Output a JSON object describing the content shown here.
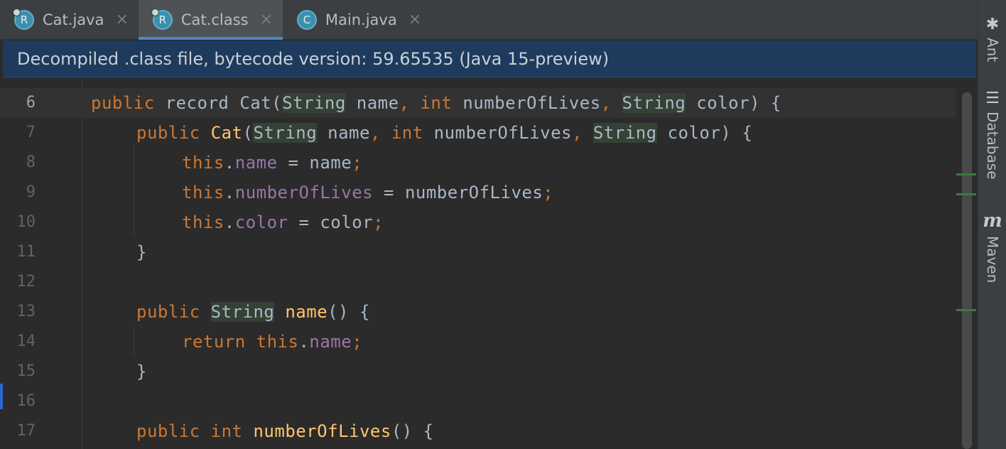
{
  "tabs": [
    {
      "icon_letter": "R",
      "label": "Cat.java",
      "close": "×",
      "active": false
    },
    {
      "icon_letter": "R",
      "label": "Cat.class",
      "close": "×",
      "active": true
    },
    {
      "icon_letter": "C",
      "label": "Main.java",
      "close": "×",
      "active": false
    }
  ],
  "banner": {
    "text": "Decompiled .class file, bytecode version: 59.65535 (Java 15-preview)"
  },
  "editor": {
    "lines": [
      {
        "num": "6"
      },
      {
        "num": "7"
      },
      {
        "num": "8"
      },
      {
        "num": "9"
      },
      {
        "num": "10"
      },
      {
        "num": "11"
      },
      {
        "num": "12"
      },
      {
        "num": "13"
      },
      {
        "num": "14"
      },
      {
        "num": "15"
      },
      {
        "num": "16"
      },
      {
        "num": "17"
      }
    ],
    "tokens": {
      "public": "public",
      "record": "record",
      "cat": "Cat",
      "string": "String",
      "int": "int",
      "this": "this",
      "return": "return",
      "name": "name",
      "numberOfLives": "numberOfLives",
      "color": "color"
    }
  },
  "tool_strip": {
    "ant": {
      "label": "Ant",
      "icon": "ant-icon"
    },
    "database": {
      "label": "Database",
      "icon": "database-icon"
    },
    "maven": {
      "label": "Maven",
      "icon": "maven-icon",
      "glyph": "m"
    }
  },
  "colors": {
    "keyword": "#cc7832",
    "function": "#ffc66d",
    "field": "#9876aa",
    "text": "#a9b7c6",
    "banner_bg": "#1e3a5c",
    "tab_underline": "#4a88c7"
  }
}
